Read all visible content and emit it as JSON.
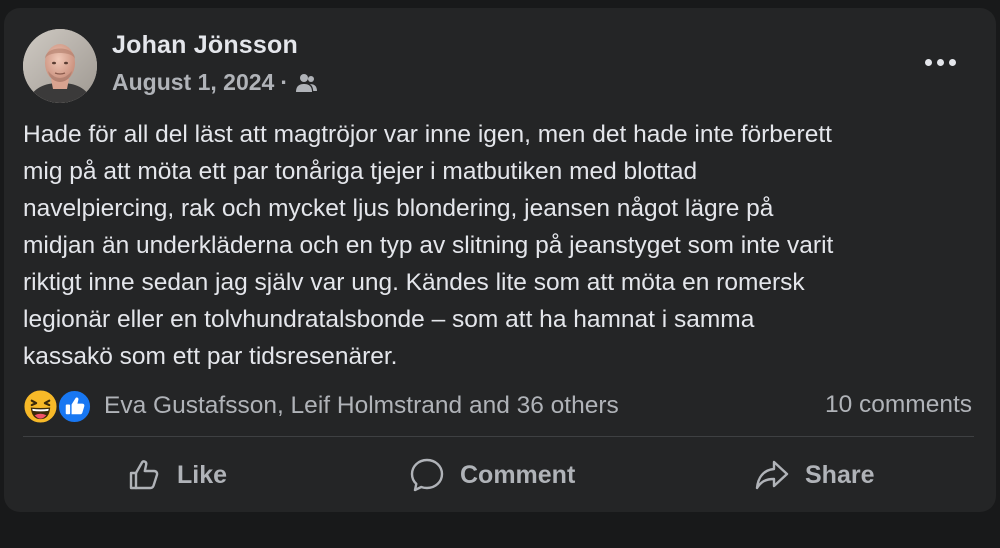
{
  "post": {
    "author": "Johan Jönsson",
    "date": "August 1, 2024",
    "separator": "·",
    "audience_icon": "friends-icon",
    "text": "Hade för all del läst att magtröjor var inne igen, men det hade inte förberett\nmig på att möta ett par tonåriga tjejer i matbutiken med blottad\nnavelpiercing, rak och mycket ljus blondering, jeansen något lägre på\nmidjan än underkläderna och en typ av slitning på jeanstyget som inte varit\nriktigt inne sedan jag själv var ung. Kändes lite som att möta en romersk\nlegionär eller en tolvhundratalsbonde – som att ha hamnat i samma\nkassakö som ett par tidsresenärer."
  },
  "reactions": {
    "icons": [
      "haha-icon",
      "like-reaction-icon"
    ],
    "names": "Eva Gustafsson, Leif Holmstrand and 36 others",
    "comments": "10 comments"
  },
  "actions": {
    "like": "Like",
    "comment": "Comment",
    "share": "Share"
  },
  "colors": {
    "background": "#18191a",
    "card": "#242526",
    "primary_text": "#e4e6eb",
    "secondary_text": "#b0b3b8",
    "like_blue": "#1877f2",
    "haha_yellow": "#f7b928"
  }
}
